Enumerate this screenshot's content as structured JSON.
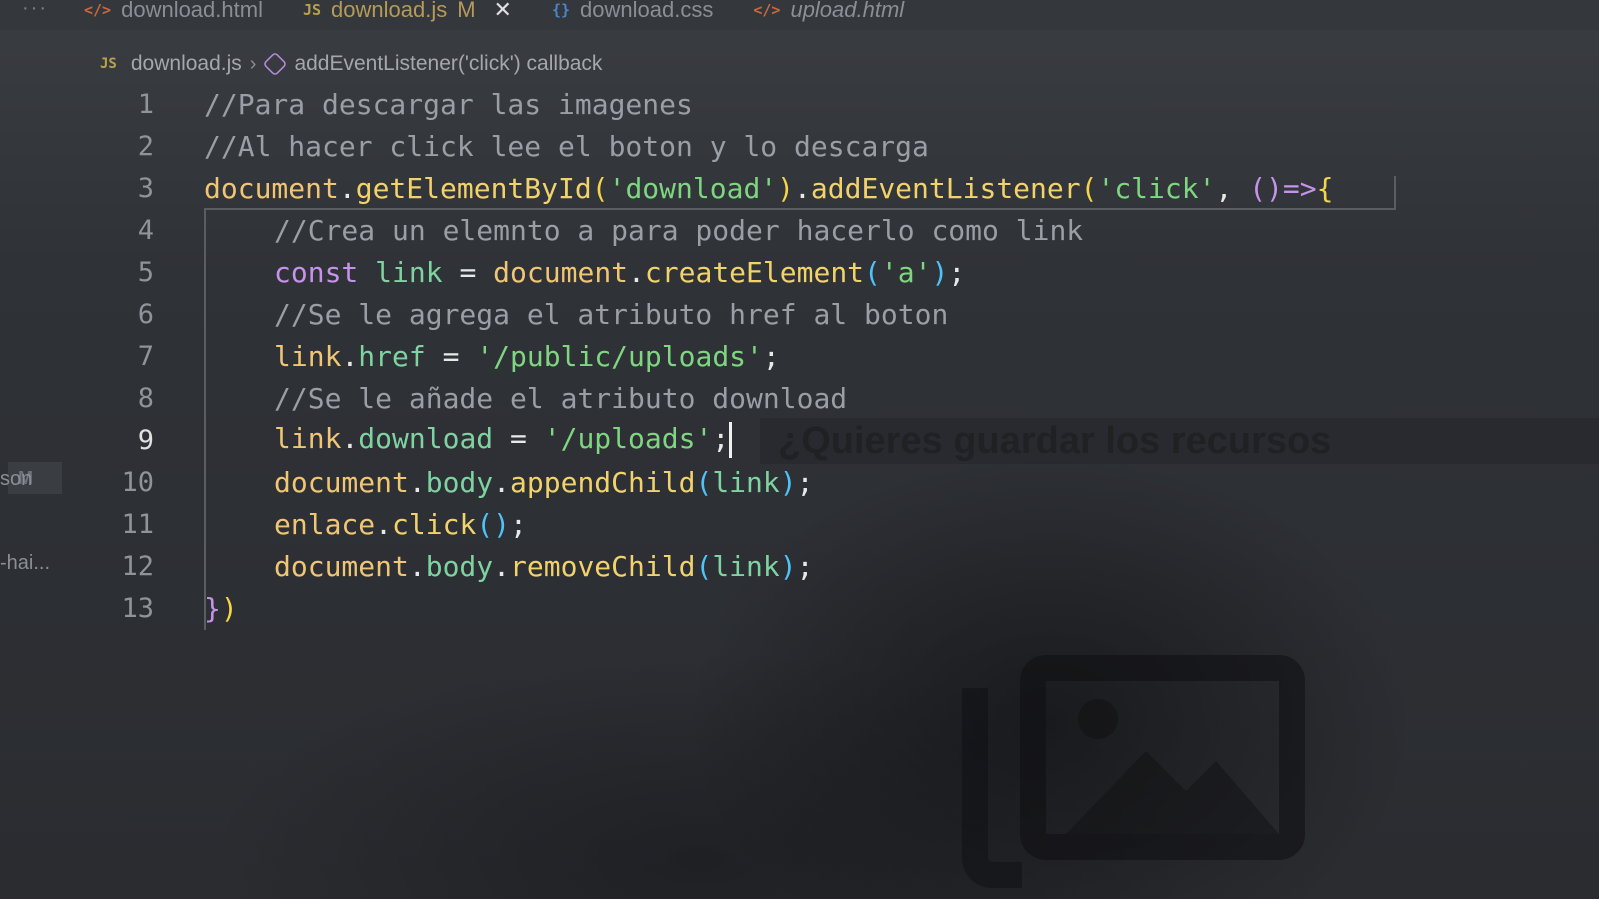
{
  "tabs": [
    {
      "icon": "</>",
      "label": "download.html",
      "badge": "",
      "close": "",
      "active": false,
      "italic": false
    },
    {
      "icon": "JS",
      "label": "download.js",
      "badge": "M",
      "close": "✕",
      "active": true,
      "italic": false
    },
    {
      "icon": "{}",
      "label": "download.css",
      "badge": "",
      "close": "",
      "active": false,
      "italic": false
    },
    {
      "icon": "</>",
      "label": "upload.html",
      "badge": "",
      "close": "",
      "active": false,
      "italic": true
    }
  ],
  "tab_more": "···",
  "breadcrumb": {
    "file_icon": "JS",
    "file": "download.js",
    "symbol": "addEventListener('click') callback"
  },
  "sidebar": {
    "modified_badge": "M",
    "label_json": "son",
    "label_hai": "-hai..."
  },
  "editor": {
    "current_line": 9,
    "line_numbers": [
      "1",
      "2",
      "3",
      "4",
      "5",
      "6",
      "7",
      "8",
      "9",
      "10",
      "11",
      "12",
      "13"
    ]
  },
  "code": {
    "l1": "//Para descargar las imagenes",
    "l2": "//Al hacer click lee el boton y lo descarga",
    "l3": {
      "obj": "document",
      "dot": ".",
      "fn": "getElementById",
      "p1": "(",
      "str": "'download'",
      "p2": ")",
      "dot2": ".",
      "fn2": "addEventListener",
      "p3": "(",
      "str2": "'click'",
      "comma": ", ",
      "args": "()",
      "arrow": "=>",
      "brace": "{"
    },
    "l4": "//Crea un elemnto a para poder hacerlo como link",
    "l5": {
      "kw": "const",
      "var": "link",
      "eq": " = ",
      "obj": "document",
      "dot": ".",
      "fn": "createElement",
      "p1": "(",
      "str": "'a'",
      "p2": ")",
      "semi": ";"
    },
    "l6": "//Se le agrega el atributo href al boton",
    "l7": {
      "var": "link",
      "dot": ".",
      "prop": "href",
      "eq": " = ",
      "str": "'/public/uploads'",
      "semi": ";"
    },
    "l8": "//Se le añade el atributo download",
    "l9": {
      "var": "link",
      "dot": ".",
      "prop": "download",
      "eq": " = ",
      "str": "'/uploads'",
      "semi": ";"
    },
    "l10": {
      "obj": "document",
      "dot": ".",
      "prop": "body",
      "dot2": ".",
      "fn": "appendChild",
      "p1": "(",
      "arg": "link",
      "p2": ")",
      "semi": ";"
    },
    "l11": {
      "obj": "enlace",
      "dot": ".",
      "fn": "click",
      "p1": "()",
      "semi": ";"
    },
    "l12": {
      "obj": "document",
      "dot": ".",
      "prop": "body",
      "dot2": ".",
      "fn": "removeChild",
      "p1": "(",
      "arg": "link",
      "p2": ")",
      "semi": ";"
    },
    "l13": {
      "brace": "}",
      "paren": ")"
    }
  },
  "overlay": {
    "dialog_reflection": "¿Quieres guardar los recursos"
  },
  "icons": {
    "image_placeholder": "image-icon"
  }
}
